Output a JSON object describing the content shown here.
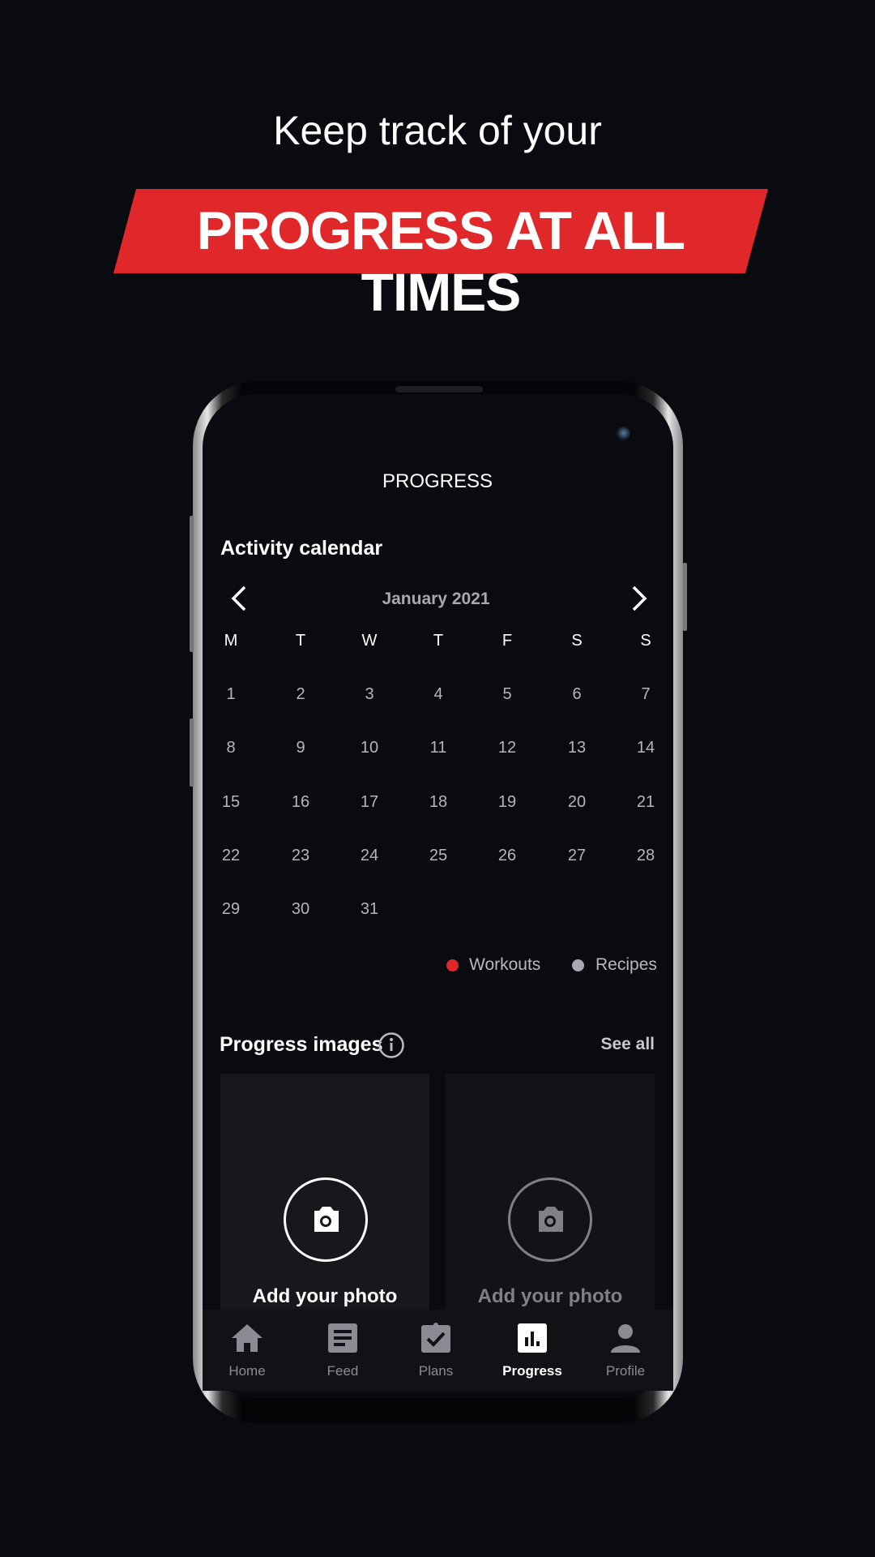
{
  "promo": {
    "headline": "Keep track of your",
    "banner": "PROGRESS AT ALL TIMES",
    "banner_color": "#e0282a"
  },
  "screen": {
    "title": "PROGRESS",
    "calendar": {
      "heading": "Activity calendar",
      "month": "January 2021",
      "prev_icon": "chevron-left-icon",
      "next_icon": "chevron-right-icon",
      "weekdays": [
        "M",
        "T",
        "W",
        "T",
        "F",
        "S",
        "S"
      ],
      "weeks": [
        [
          "1",
          "2",
          "3",
          "4",
          "5",
          "6",
          "7"
        ],
        [
          "8",
          "9",
          "10",
          "11",
          "12",
          "13",
          "14"
        ],
        [
          "15",
          "16",
          "17",
          "18",
          "19",
          "20",
          "21"
        ],
        [
          "22",
          "23",
          "24",
          "25",
          "26",
          "27",
          "28"
        ],
        [
          "29",
          "30",
          "31"
        ]
      ],
      "legend": [
        {
          "label": "Workouts",
          "color": "#e0282a"
        },
        {
          "label": "Recipes",
          "color": "#a9a9b2"
        }
      ]
    },
    "progress_images": {
      "heading": "Progress images",
      "info_icon": "info-icon",
      "see_all": "See all",
      "cards": [
        {
          "label": "Add your photo",
          "icon": "camera-icon"
        },
        {
          "label": "Add your photo",
          "icon": "camera-icon"
        }
      ]
    },
    "nav": [
      {
        "label": "Home",
        "icon": "home-icon",
        "active": false
      },
      {
        "label": "Feed",
        "icon": "feed-icon",
        "active": false
      },
      {
        "label": "Plans",
        "icon": "clipboard-check-icon",
        "active": false
      },
      {
        "label": "Progress",
        "icon": "bar-chart-icon",
        "active": true
      },
      {
        "label": "Profile",
        "icon": "person-icon",
        "active": false
      }
    ]
  }
}
